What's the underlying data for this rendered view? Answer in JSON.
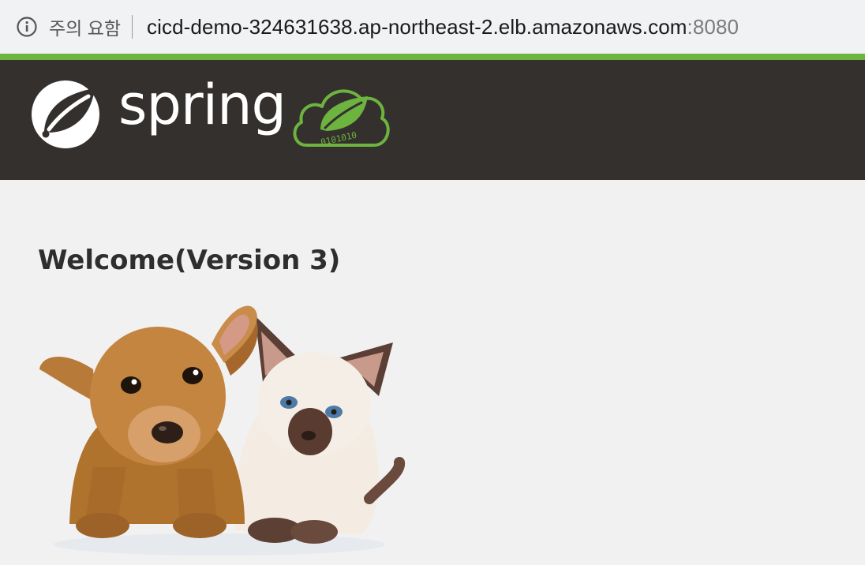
{
  "browser": {
    "security_label": "주의 요함",
    "url_host": "cicd-demo-324631638.ap-northeast-2.elb.amazonaws.com",
    "url_port": ":8080"
  },
  "header": {
    "logo_text": "spring",
    "cloud_binary": "0101010"
  },
  "main": {
    "title": "Welcome(Version 3)"
  },
  "colors": {
    "spring_green": "#6db33f",
    "navbar_bg": "#34302d",
    "page_bg": "#f1f1f1"
  }
}
